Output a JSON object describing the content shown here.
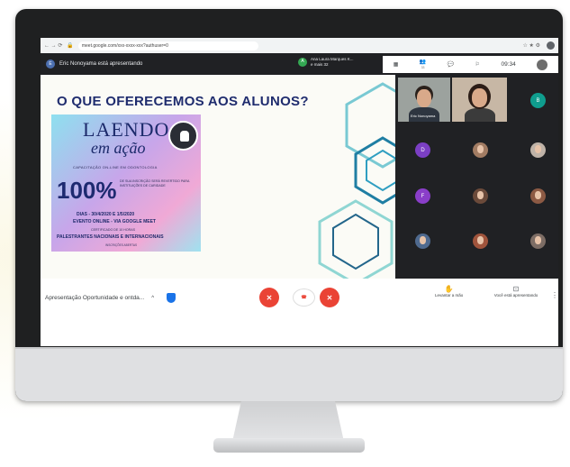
{
  "browser": {
    "nav_icons": "← → ⟳",
    "url": "meet.google.com/xxx-xxxx-xxx?authuser=0",
    "right_icons": "☆ ★ ⚙"
  },
  "meet": {
    "presenter_initial": "E",
    "presenter_banner": "Eric Nonoyama está apresentando",
    "pinned_initial": "A",
    "pinned_name": "Ana Laura Marques K...",
    "pinned_more": "e mais 32",
    "toolbar": {
      "grid_label": "▦",
      "people_label": "👥",
      "chat_label": "💬",
      "activities_label": "⚐",
      "clock": "09:34",
      "people_count": "33"
    }
  },
  "slide": {
    "title": "O QUE OFERECEMOS AOS ALUNOS?",
    "poster": {
      "brand_line1": "LAENDO",
      "brand_line2": "em ação",
      "subtitle": "CAPACITAÇÃO ON-LINE EM ODONTOLOGIA",
      "percent": "100%",
      "percent_note": "DE SUA INSCRIÇÃO SERÁ REVERTIDO PARA INSTITUIÇÕES DE CARIDADE",
      "dias": "DIAS - 30/4/2020 E 1/5/2020",
      "evento": "EVENTO ONLINE - VIA GOOGLE MEET",
      "certificado": "CERTIFICADO DE 10 HORAS",
      "palestrantes": "PALESTRANTES NACIONAIS E INTERNACIONAIS",
      "footer": "INSCRIÇÕES ABERTAS"
    }
  },
  "participants": {
    "video1_caption": "Eric Nonoyama",
    "avatar_initials": [
      "B",
      "D",
      "F"
    ]
  },
  "bottom_bar": {
    "meeting_name": "Apresentação Oportunidade e ontda...",
    "chevron": "^",
    "mic_icon": "✕",
    "hangup_label": "☎",
    "cam_icon": "✕",
    "raise_hand_label": "Levantar a mão",
    "present_label": "Você está apresentando",
    "kebab": "⋮"
  }
}
